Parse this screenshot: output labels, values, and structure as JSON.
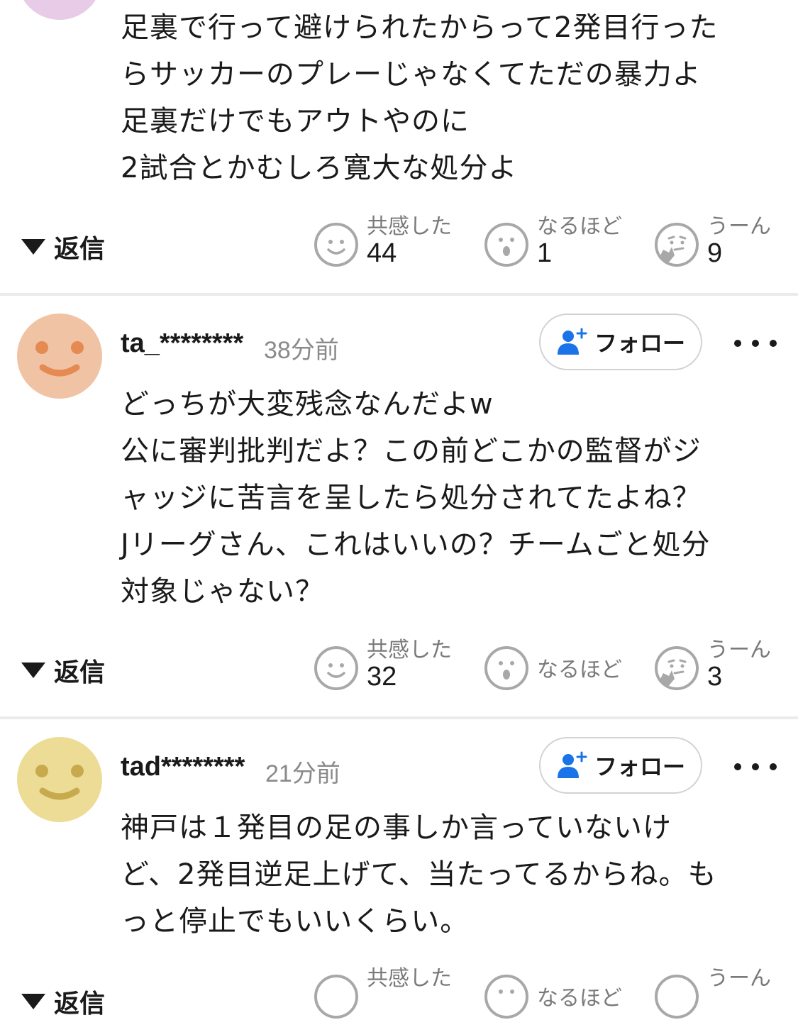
{
  "comments": [
    {
      "lines": [
        "足裏で行って避けられたからって2発目行った",
        "らサッカーのプレーじゃなくてただの暴力よ",
        "足裏だけでもアウトやのに",
        "2試合とかむしろ寛大な処分よ"
      ],
      "reply_label": "返信",
      "reactions": {
        "empathy": {
          "label": "共感した",
          "count": "44"
        },
        "naruhodo": {
          "label": "なるほど",
          "count": "1"
        },
        "uun": {
          "label": "うーん",
          "count": "9"
        }
      }
    },
    {
      "user": "ta_********",
      "time": "38分前",
      "follow_label": "フォロー",
      "avatar_color": "#f0c3a4",
      "avatar_feature_color": "#e58a52",
      "lines": [
        "どっちが大変残念なんだよw",
        "公に審判批判だよ？この前どこかの監督がジ",
        "ャッジに苦言を呈したら処分されてたよね？",
        "Jリーグさん、これはいいの？チームごと処分",
        "対象じゃない？"
      ],
      "reply_label": "返信",
      "reactions": {
        "empathy": {
          "label": "共感した",
          "count": "32"
        },
        "naruhodo": {
          "label": "なるほど",
          "count": ""
        },
        "uun": {
          "label": "うーん",
          "count": "3"
        }
      }
    },
    {
      "user": "tad********",
      "time": "21分前",
      "follow_label": "フォロー",
      "avatar_color": "#ecdc96",
      "avatar_feature_color": "#c8aa4e",
      "lines": [
        "神戸は１発目の足の事しか言っていないけ",
        "ど、2発目逆足上げて、当たってるからね。も",
        "っと停止でもいいくらい。"
      ],
      "reply_label": "返信",
      "reactions": {
        "empathy": {
          "label": "共感した",
          "count": ""
        },
        "naruhodo": {
          "label": "なるほど",
          "count": ""
        },
        "uun": {
          "label": "うーん",
          "count": ""
        }
      }
    }
  ],
  "colors": {
    "follow_icon": "#1a73e8",
    "reaction_icon": "#a8a8a8",
    "top_avatar": "#e8cbe6"
  }
}
